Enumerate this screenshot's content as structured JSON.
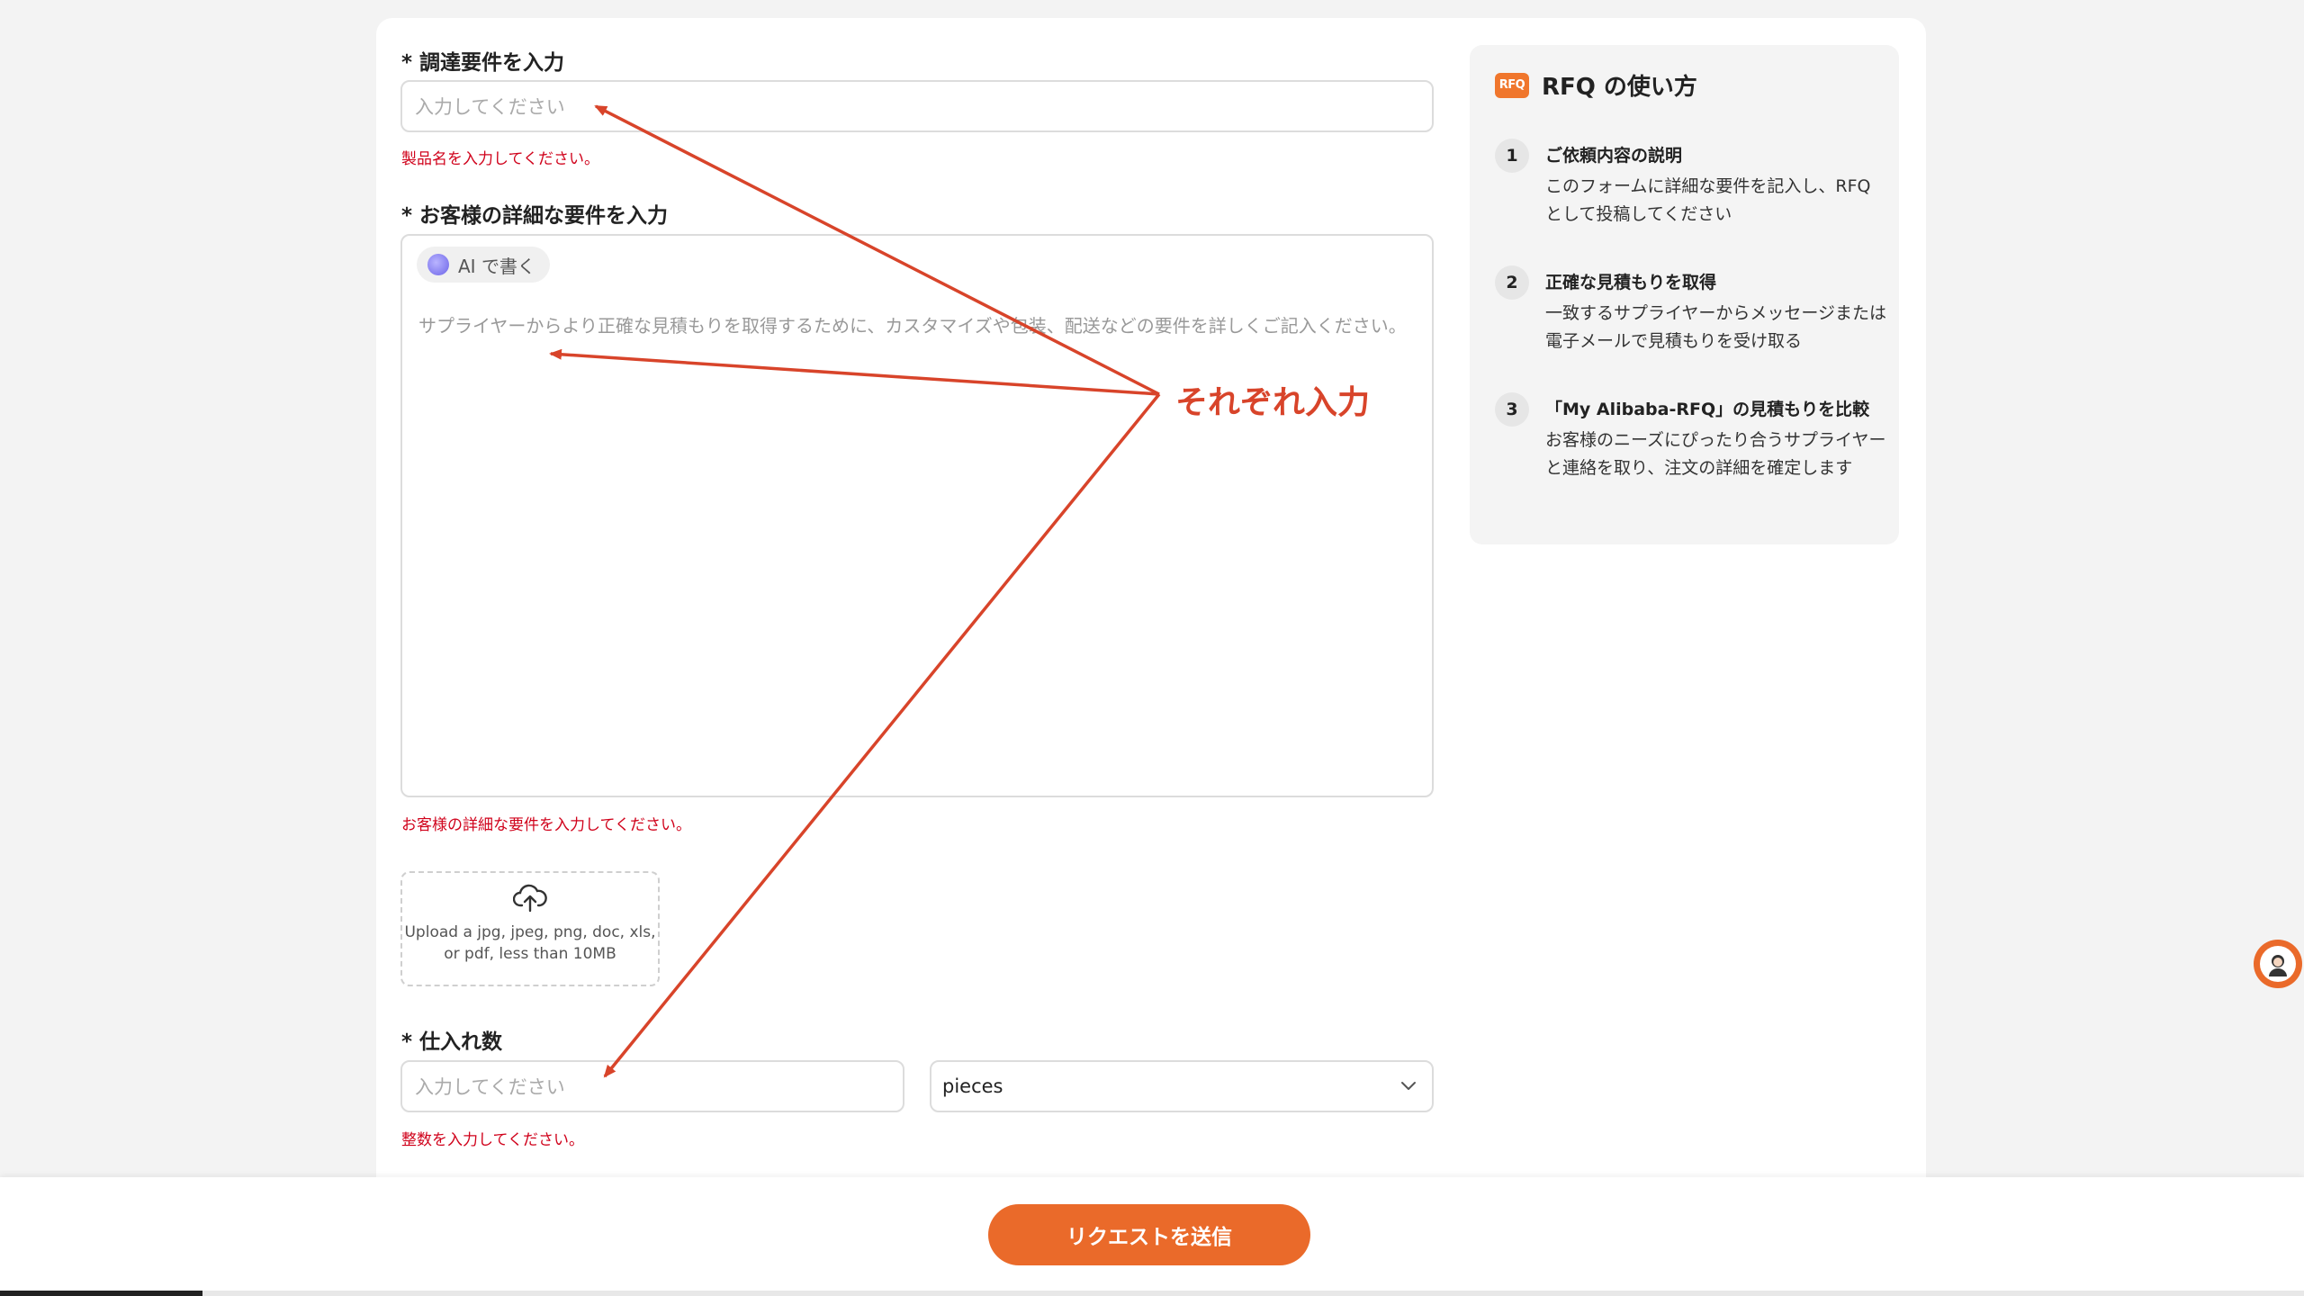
{
  "form": {
    "field1": {
      "label": "* 調達要件を入力",
      "placeholder": "入力してください",
      "error": "製品名を入力してください。"
    },
    "field2": {
      "label": "* お客様の詳細な要件を入力",
      "ai_button": "AI で書く",
      "placeholder": "サプライヤーからより正確な見積もりを取得するために、カスタマイズや包装、配送などの要件を詳しくご記入ください。",
      "error": "お客様の詳細な要件を入力してください。"
    },
    "upload": {
      "icon": "cloud-upload-icon",
      "text_line1": "Upload a jpg, jpeg, png, doc, xls,",
      "text_line2": "or pdf, less than 10MB"
    },
    "quantity": {
      "label": "* 仕入れ数",
      "placeholder": "入力してください",
      "unit_selected": "pieces",
      "error": "整数を入力してください。"
    },
    "submit_label": "リクエストを送信"
  },
  "help": {
    "badge": "RFQ",
    "title": "RFQ の使い方",
    "steps": [
      {
        "num": "1",
        "title": "ご依頼内容の説明",
        "desc": "このフォームに詳細な要件を記入し、RFQ として投稿してください"
      },
      {
        "num": "2",
        "title": "正確な見積もりを取得",
        "desc": "一致するサプライヤーからメッセージまたは電子メールで見積もりを受け取る"
      },
      {
        "num": "3",
        "title": "「My Alibaba-RFQ」の見積もりを比較",
        "desc": "お客様のニーズにぴったり合うサプライヤーと連絡を取り、注文の詳細を確定します"
      }
    ]
  },
  "annotation": {
    "text": "それぞれ入力",
    "color": "#d8442a"
  },
  "colors": {
    "accent": "#ea6a2a",
    "error": "#d0021b"
  }
}
